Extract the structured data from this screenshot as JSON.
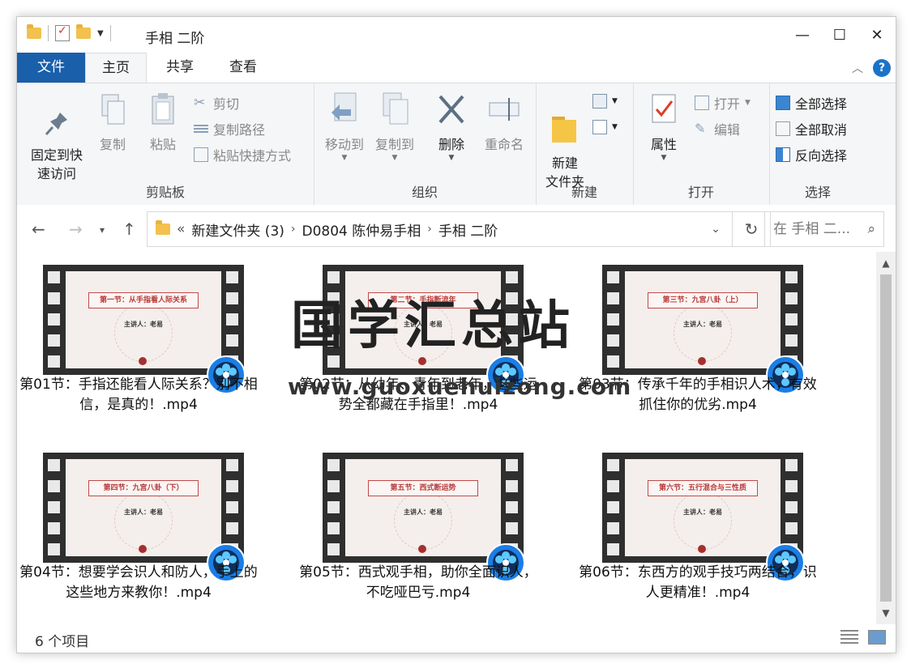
{
  "window": {
    "title": "手相 二阶"
  },
  "ribbon_tabs": {
    "file": "文件",
    "home": "主页",
    "share": "共享",
    "view": "查看"
  },
  "clipboard": {
    "pin": "固定到快\n速访问",
    "copy": "复制",
    "paste": "粘贴",
    "cut": "剪切",
    "copy_path": "复制路径",
    "paste_shortcut": "粘贴快捷方式",
    "label": "剪贴板"
  },
  "organize": {
    "move_to": "移动到",
    "copy_to": "复制到",
    "delete": "删除",
    "rename": "重命名",
    "label": "组织"
  },
  "new_group": {
    "new_folder": "新建\n文件夹",
    "label": "新建"
  },
  "open_group": {
    "properties": "属性",
    "open": "打开",
    "edit": "编辑",
    "label": "打开"
  },
  "select_group": {
    "select_all": "全部选择",
    "select_none": "全部取消",
    "invert": "反向选择",
    "label": "选择"
  },
  "address": {
    "overflow": "«",
    "crumbs": [
      "新建文件夹 (3)",
      "D0804 陈仲易手相",
      "手相 二阶"
    ]
  },
  "search": {
    "placeholder": "在 手相 二..."
  },
  "files": [
    {
      "name": "第01节：手指还能看人际关系？别不相信，是真的！.mp4",
      "slide_title": "第一节：从手指看人际关系",
      "presenter": "主讲人：老易"
    },
    {
      "name": "第02节：从幼年、青年到老年，这些运势全都藏在手指里！.mp4",
      "slide_title": "第二节：手指断流年",
      "presenter": "主讲人：老易"
    },
    {
      "name": "第03节：传承千年的手相识人术，有效抓住你的优劣.mp4",
      "slide_title": "第三节：九宫八卦（上）",
      "presenter": "主讲人：老易"
    },
    {
      "name": "第04节：想要学会识人和防人，手上的这些地方来教你！.mp4",
      "slide_title": "第四节：九宫八卦（下）",
      "presenter": "主讲人：老易"
    },
    {
      "name": "第05节：西式观手相，助你全面识人，不吃哑巴亏.mp4",
      "slide_title": "第五节：西式断运势",
      "presenter": "主讲人：老易"
    },
    {
      "name": "第06节：东西方的观手技巧两结合，识人更精准！.mp4",
      "slide_title": "第六节：五行混合与三性质",
      "presenter": "主讲人：老易"
    }
  ],
  "watermark": {
    "cn": "国学汇总站",
    "url": "www.guoxuehuizong.com"
  },
  "status": {
    "count": "6 个项目"
  }
}
